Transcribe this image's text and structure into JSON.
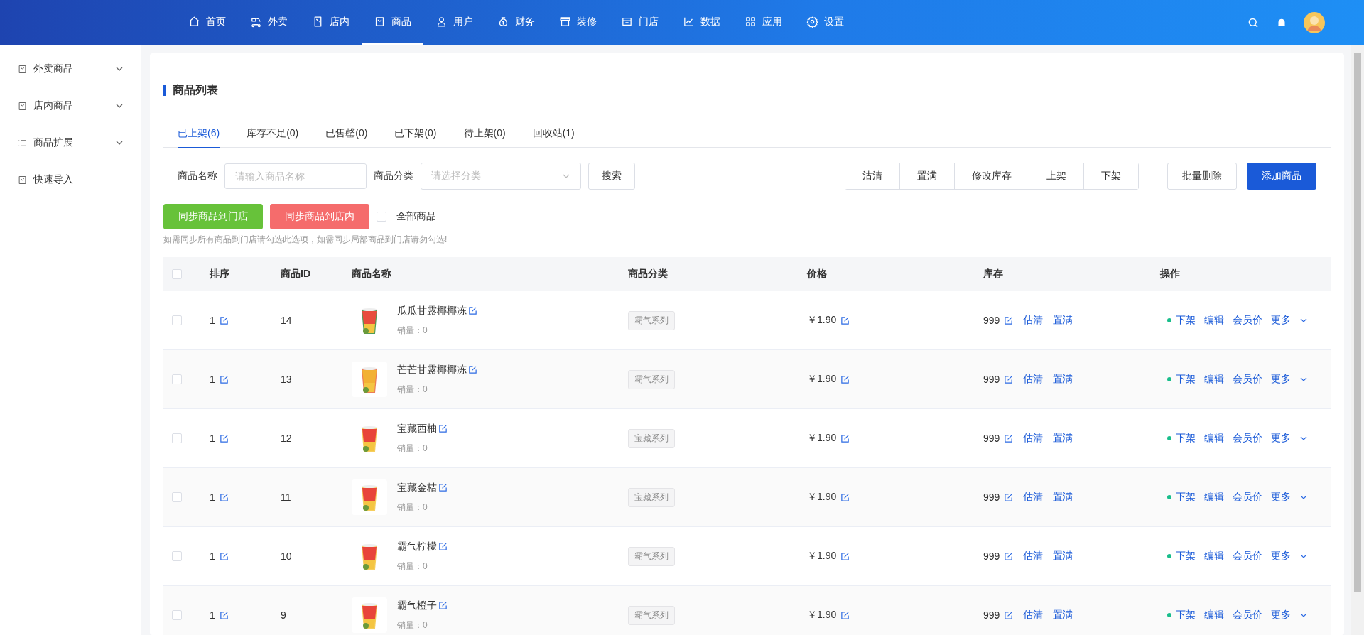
{
  "nav": {
    "items": [
      {
        "label": "首页",
        "selected": false
      },
      {
        "label": "外卖",
        "selected": false
      },
      {
        "label": "店内",
        "selected": false
      },
      {
        "label": "商品",
        "selected": true
      },
      {
        "label": "用户",
        "selected": false
      },
      {
        "label": "财务",
        "selected": false
      },
      {
        "label": "装修",
        "selected": false
      },
      {
        "label": "门店",
        "selected": false
      },
      {
        "label": "数据",
        "selected": false
      },
      {
        "label": "应用",
        "selected": false
      },
      {
        "label": "设置",
        "selected": false
      }
    ]
  },
  "sidebar": {
    "items": [
      {
        "label": "外卖商品",
        "kind": "group",
        "expanded": false
      },
      {
        "label": "店内商品",
        "kind": "group",
        "expanded": false
      },
      {
        "label": "商品扩展",
        "kind": "group",
        "expanded": false
      },
      {
        "label": "快速导入",
        "kind": "link"
      }
    ]
  },
  "page_title": "商品列表",
  "tabs": [
    {
      "label": "已上架(6)",
      "selected": true
    },
    {
      "label": "库存不足(0)",
      "selected": false
    },
    {
      "label": "已售罄(0)",
      "selected": false
    },
    {
      "label": "已下架(0)",
      "selected": false
    },
    {
      "label": "待上架(0)",
      "selected": false
    },
    {
      "label": "回收站(1)",
      "selected": false
    }
  ],
  "filters": {
    "name_label": "商品名称",
    "name_placeholder": "请输入商品名称",
    "category_label": "商品分类",
    "category_placeholder": "请选择分类",
    "search_button": "搜索"
  },
  "batch_buttons": [
    "沽清",
    "置满",
    "修改库存",
    "上架",
    "下架"
  ],
  "delete_button": "批量删除",
  "add_button": "添加商品",
  "sync": {
    "to_store": "同步商品到门店",
    "to_dine_in": "同步商品到店内",
    "all_label": "全部商品",
    "all_checked": false,
    "hint": "如需同步所有商品到门店请勾选此选项，如需同步局部商品到门店请勿勾选!"
  },
  "table": {
    "select_all_checked": false,
    "columns": [
      "排序",
      "商品ID",
      "商品名称",
      "商品分类",
      "价格",
      "库存",
      "操作"
    ],
    "rows": [
      {
        "checked": false,
        "sort": "1",
        "id": "14",
        "name": "瓜瓜甘露椰椰冻",
        "sales": "销量：0",
        "category": "霸气系列",
        "price": "￥1.90",
        "stock": "999",
        "actions": [
          "估清",
          "置满"
        ],
        "ops": [
          "下架",
          "编辑",
          "会员价",
          "更多"
        ]
      },
      {
        "checked": false,
        "sort": "1",
        "id": "13",
        "name": "芒芒甘露椰椰冻",
        "sales": "销量：0",
        "category": "霸气系列",
        "price": "￥1.90",
        "stock": "999",
        "actions": [
          "估清",
          "置满"
        ],
        "ops": [
          "下架",
          "编辑",
          "会员价",
          "更多"
        ]
      },
      {
        "checked": false,
        "sort": "1",
        "id": "12",
        "name": "宝藏西柚",
        "sales": "销量：0",
        "category": "宝藏系列",
        "price": "￥1.90",
        "stock": "999",
        "actions": [
          "估清",
          "置满"
        ],
        "ops": [
          "下架",
          "编辑",
          "会员价",
          "更多"
        ]
      },
      {
        "checked": false,
        "sort": "1",
        "id": "11",
        "name": "宝藏金桔",
        "sales": "销量：0",
        "category": "宝藏系列",
        "price": "￥1.90",
        "stock": "999",
        "actions": [
          "估清",
          "置满"
        ],
        "ops": [
          "下架",
          "编辑",
          "会员价",
          "更多"
        ]
      },
      {
        "checked": false,
        "sort": "1",
        "id": "10",
        "name": "霸气柠檬",
        "sales": "销量：0",
        "category": "霸气系列",
        "price": "￥1.90",
        "stock": "999",
        "actions": [
          "估清",
          "置满"
        ],
        "ops": [
          "下架",
          "编辑",
          "会员价",
          "更多"
        ]
      },
      {
        "checked": false,
        "sort": "1",
        "id": "9",
        "name": "霸气橙子",
        "sales": "销量：0",
        "category": "霸气系列",
        "price": "￥1.90",
        "stock": "999",
        "actions": [
          "估清",
          "置满"
        ],
        "ops": [
          "下架",
          "编辑",
          "会员价",
          "更多"
        ]
      }
    ]
  }
}
